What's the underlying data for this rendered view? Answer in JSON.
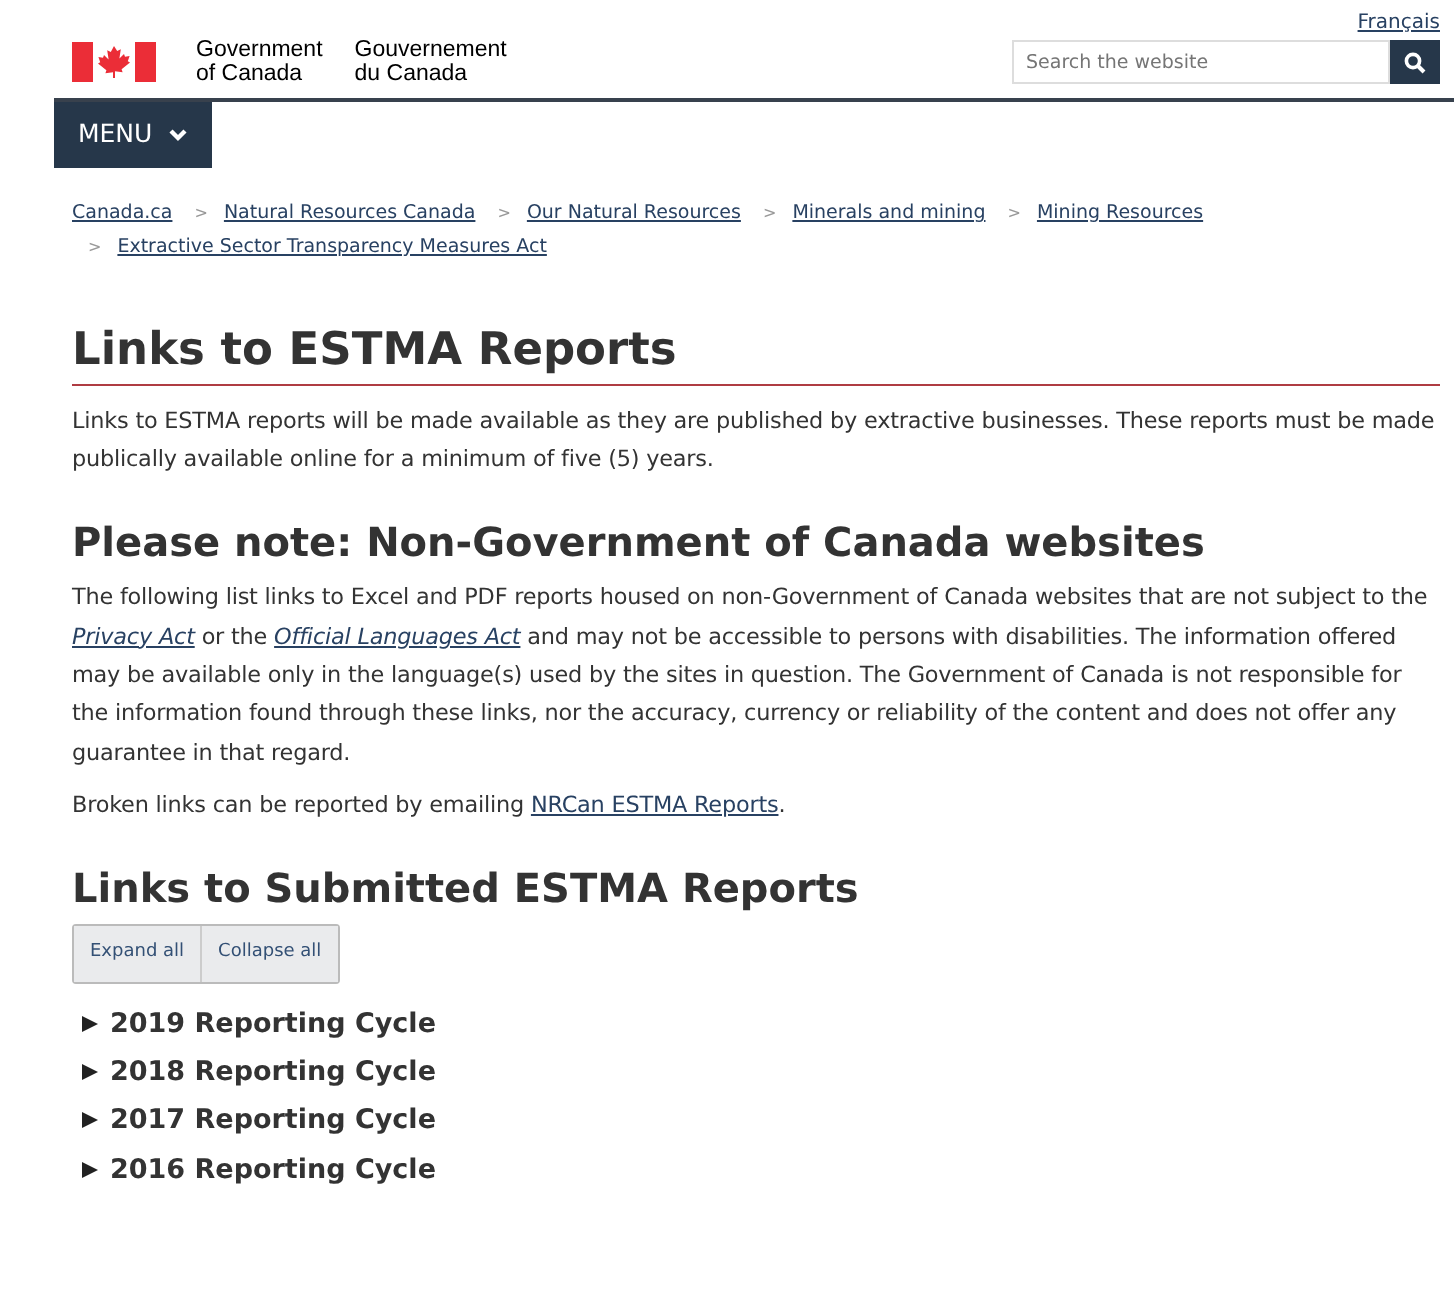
{
  "language_link": "Français",
  "brand": {
    "english": [
      "Government",
      "of Canada"
    ],
    "french": [
      "Gouvernement",
      "du Canada"
    ]
  },
  "search": {
    "placeholder": "Search the website"
  },
  "menu_button": "MENU",
  "breadcrumbs": [
    "Canada.ca",
    "Natural Resources Canada",
    "Our Natural Resources",
    "Minerals and mining",
    "Mining Resources",
    "Extractive Sector Transparency Measures Act"
  ],
  "breadcrumb_separator": ">",
  "sections": [
    {
      "heading": "Links to ESTMA Reports",
      "kind": "title",
      "paragraphs": [
        [
          {
            "kind": "text",
            "text": "Links to ESTMA reports will be made available as they are published by extractive businesses. These reports must be made publically available online for a minimum of five (5) years."
          }
        ]
      ]
    },
    {
      "heading": "Please note: Non-Government of Canada websites",
      "kind": "heading",
      "paragraphs": [
        [
          {
            "kind": "text",
            "text": "The following list links to Excel and PDF reports housed on non-Government of Canada websites that are not subject to the "
          },
          {
            "kind": "link",
            "text": "Privacy Act",
            "italic": true
          },
          {
            "kind": "text",
            "text": " or the "
          },
          {
            "kind": "link",
            "text": "Official Languages Act",
            "italic": true
          },
          {
            "kind": "text",
            "text": " and may not be accessible to persons with disabilities. The information offered may be available only in the language(s) used by the sites in question. The Government of Canada is not responsible for the information found through these links, nor the accuracy, currency or reliability of the content and does not offer any guarantee in that regard."
          }
        ],
        [
          {
            "kind": "text",
            "text": "Broken links can be reported by emailing "
          },
          {
            "kind": "link",
            "text": "NRCan ESTMA Reports",
            "italic": false
          },
          {
            "kind": "text",
            "text": "."
          }
        ]
      ]
    },
    {
      "heading": "Links to Submitted ESTMA Reports",
      "kind": "heading"
    }
  ],
  "toggle_buttons": [
    "Expand all",
    "Collapse all"
  ],
  "cycles": [
    {
      "label": "2019 Reporting Cycle",
      "expanded": false
    },
    {
      "label": "2018 Reporting Cycle",
      "expanded": false
    },
    {
      "label": "2017 Reporting Cycle",
      "expanded": false
    },
    {
      "label": "2016 Reporting Cycle",
      "expanded": false
    }
  ]
}
